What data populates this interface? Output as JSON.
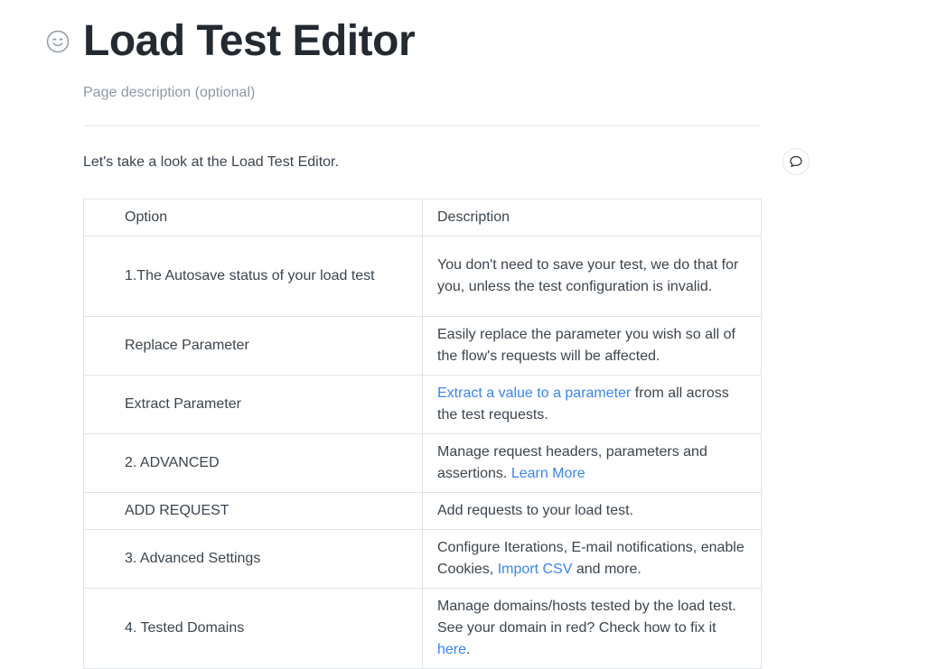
{
  "page": {
    "title": "Load Test Editor",
    "description_placeholder": "Page description (optional)",
    "intro": "Let's take a look at the Load Test Editor."
  },
  "icons": {
    "emoji": "smiley-face-icon",
    "comment": "comment-bubble-icon"
  },
  "colors": {
    "title": "#242a31",
    "text": "#3b454e",
    "muted": "#8c9aa6",
    "link": "#3884ff",
    "border": "#dfe4e9"
  },
  "table": {
    "headers": [
      "Option",
      "Description"
    ],
    "rows": [
      {
        "option": "1.The Autosave status of your load test",
        "desc": [
          {
            "text": "You don't need to save your test, we do that for you, unless the test configuration is invalid."
          }
        ]
      },
      {
        "option": "Replace Parameter",
        "desc": [
          {
            "text": "Easily replace the parameter you wish so all of the flow's requests will be affected."
          }
        ]
      },
      {
        "option": "Extract Parameter",
        "desc": [
          {
            "text": "Extract a value to a parameter",
            "link": true
          },
          {
            "text": " from all across the test requests."
          }
        ]
      },
      {
        "option": "2. ADVANCED",
        "desc": [
          {
            "text": "Manage request headers, parameters and assertions. "
          },
          {
            "text": "Learn More",
            "link": true
          }
        ]
      },
      {
        "option": "ADD REQUEST",
        "desc": [
          {
            "text": "Add requests to your load test."
          }
        ]
      },
      {
        "option": "3. Advanced Settings",
        "desc": [
          {
            "text": "Configure Iterations, E-mail notifications, enable Cookies, "
          },
          {
            "text": "Import CSV",
            "link": true
          },
          {
            "text": " and more."
          }
        ]
      },
      {
        "option": "4. Tested Domains",
        "desc": [
          {
            "text": "Manage domains/hosts tested by the load test. See your domain in red? Check how to fix it "
          },
          {
            "text": "here",
            "link": true
          },
          {
            "text": "."
          }
        ]
      }
    ]
  }
}
